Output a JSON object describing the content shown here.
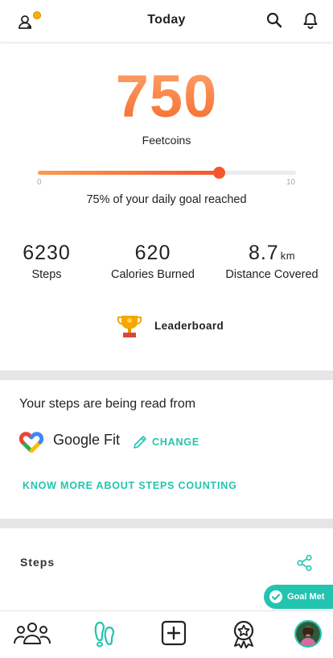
{
  "header": {
    "title": "Today",
    "icons": [
      "add-user-coin-icon",
      "search-icon",
      "bell-icon"
    ]
  },
  "summary": {
    "coins": "750",
    "coins_label": "Feetcoins",
    "progress_fraction": 0.7,
    "progress_min": "0",
    "progress_max": "10",
    "goal_text": "75% of your daily goal reached"
  },
  "stats": [
    {
      "value": "6230",
      "unit": "",
      "label": "Steps"
    },
    {
      "value": "620",
      "unit": "",
      "label": "Calories Burned"
    },
    {
      "value": "8.7",
      "unit": "km",
      "label": "Distance Covered"
    }
  ],
  "leaderboard": {
    "label": "Leaderboard",
    "icon": "trophy-icon"
  },
  "source": {
    "title": "Your steps are being read from",
    "provider": "Google Fit",
    "provider_icon": "google-fit-heart-icon",
    "change_label": "CHANGE",
    "know_more_label": "KNOW MORE ABOUT STEPS COUNTING"
  },
  "steps_section": {
    "title": "Steps",
    "share_icon": "share-icon"
  },
  "goal_badge": {
    "label": "Goal Met",
    "icon": "check-circle-icon"
  },
  "bottom_nav": [
    {
      "name": "community",
      "icon": "group-icon"
    },
    {
      "name": "feet",
      "icon": "footprints-icon"
    },
    {
      "name": "add",
      "icon": "plus-square-icon"
    },
    {
      "name": "rewards",
      "icon": "badge-star-icon"
    },
    {
      "name": "profile",
      "icon": "avatar"
    }
  ],
  "colors": {
    "accent": "#22c4b0",
    "orange": "#f4572e",
    "orange_light": "#ffa36c",
    "divider": "#e6e6e6"
  }
}
